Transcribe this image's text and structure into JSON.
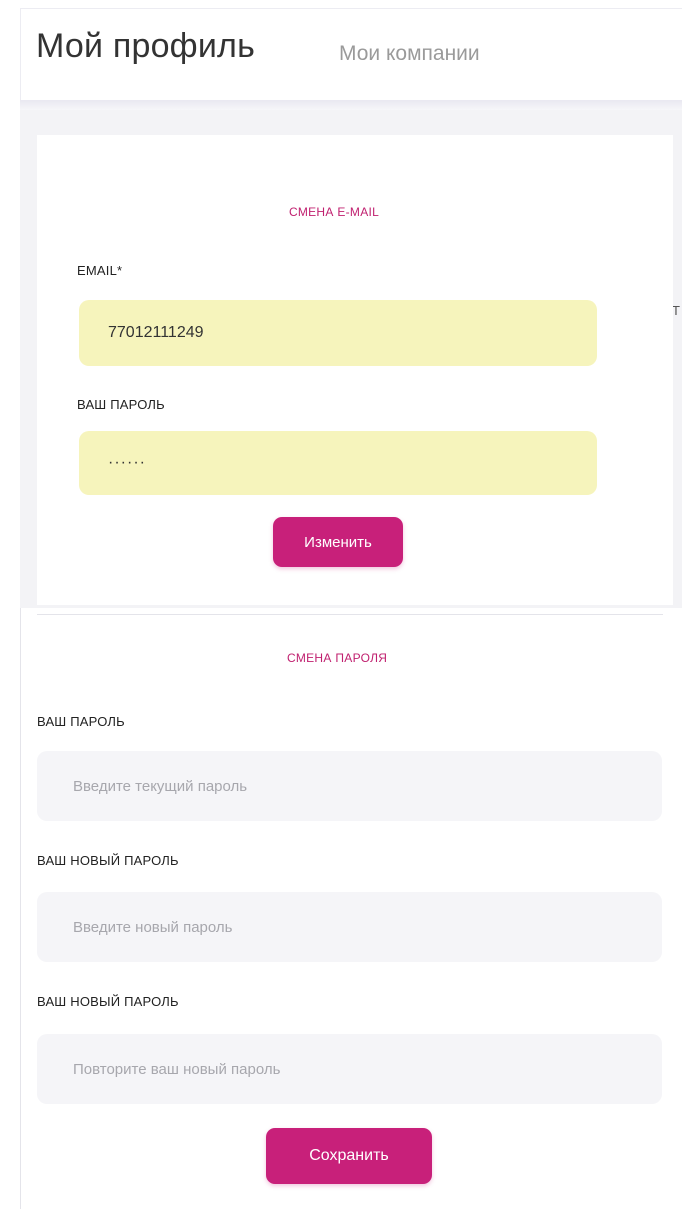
{
  "header": {
    "title": "Мой профиль",
    "tab_companies": "Мои компании"
  },
  "edge": {
    "text": "Т"
  },
  "email_section": {
    "title": "СМЕНА E-MAIL",
    "email_label": "EMAIL*",
    "email_value": "77012111249",
    "password_label": "ВАШ ПАРОЛЬ",
    "password_value": "······",
    "submit_label": "Изменить"
  },
  "password_section": {
    "title": "СМЕНА ПАРОЛЯ",
    "current_label": "ВАШ ПАРОЛЬ",
    "current_placeholder": "Введите текущий пароль",
    "new_label": "ВАШ НОВЫЙ ПАРОЛЬ",
    "new_placeholder": "Введите новый пароль",
    "repeat_label": "ВАШ НОВЫЙ ПАРОЛЬ",
    "repeat_placeholder": "Повторите ваш новый пароль",
    "submit_label": "Сохранить"
  },
  "colors": {
    "accent": "#c8207a",
    "autofill": "#f6f4bc",
    "input_bg": "#f5f5f8"
  }
}
